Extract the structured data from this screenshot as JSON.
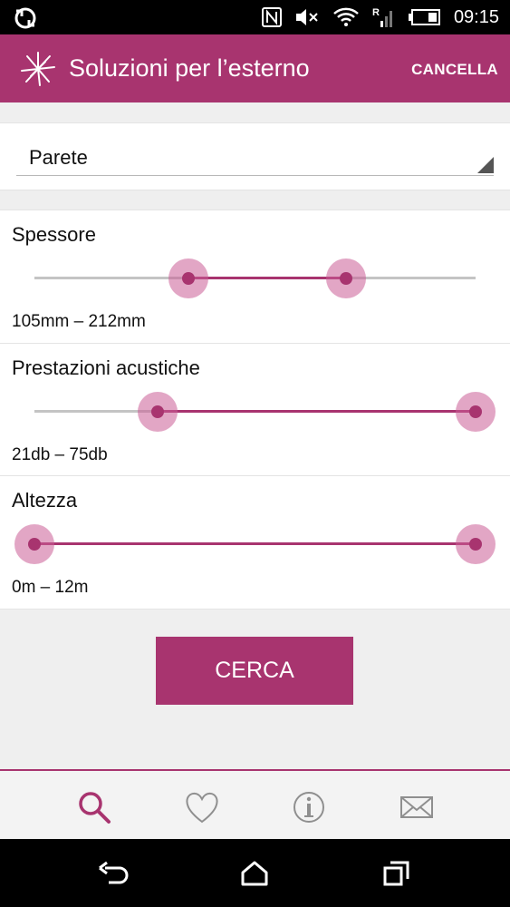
{
  "status_bar": {
    "time": "09:15",
    "icons": [
      "sync-icon",
      "nfc-icon",
      "mute-icon",
      "wifi-icon",
      "signal-icon",
      "battery-icon"
    ]
  },
  "app_bar": {
    "title": "Soluzioni per l’esterno",
    "action_label": "CANCELLA",
    "logo_icon": "starburst-logo-icon"
  },
  "filters": {
    "type_select": {
      "value": "Parete"
    },
    "sliders": [
      {
        "label": "Spessore",
        "range_text": "105mm – 212mm",
        "low_fraction": 0.35,
        "high_fraction": 0.706
      },
      {
        "label": "Prestazioni acustiche",
        "range_text": "21db – 75db",
        "low_fraction": 0.279,
        "high_fraction": 1.0
      },
      {
        "label": "Altezza",
        "range_text": "0m – 12m",
        "low_fraction": 0.0,
        "high_fraction": 1.0
      }
    ]
  },
  "search_button": {
    "label": "CERCA"
  },
  "bottom_nav": {
    "tabs": [
      {
        "icon": "search-icon",
        "active": true
      },
      {
        "icon": "heart-icon",
        "active": false
      },
      {
        "icon": "info-icon",
        "active": false
      },
      {
        "icon": "mail-icon",
        "active": false
      }
    ]
  },
  "system_nav": {
    "buttons": [
      "back-icon",
      "home-icon",
      "recents-icon"
    ]
  },
  "colors": {
    "accent": "#a8346f",
    "thumb_halo": "#ca5c96",
    "background": "#efefef"
  }
}
